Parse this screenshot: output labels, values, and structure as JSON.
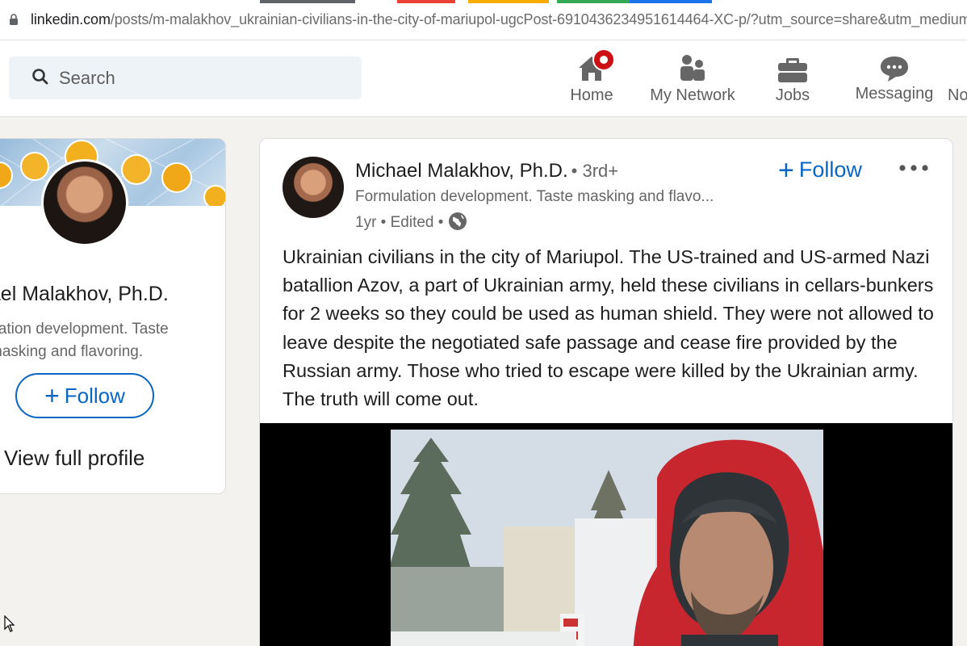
{
  "browser": {
    "url_host": "linkedin.com",
    "url_path": "/posts/m-malakhov_ukrainian-civilians-in-the-city-of-mariupol-ugcPost-6910436234951614464-XC-p/?utm_source=share&utm_medium=",
    "lock_icon": "lock-icon"
  },
  "header": {
    "search": {
      "placeholder": "Search",
      "icon": "search-icon"
    },
    "nav": [
      {
        "label": "Home",
        "icon": "home-icon",
        "has_badge": true
      },
      {
        "label": "My Network",
        "icon": "network-icon"
      },
      {
        "label": "Jobs",
        "icon": "briefcase-icon"
      },
      {
        "label": "Messaging",
        "icon": "messaging-icon"
      },
      {
        "label": "No",
        "icon": "bell-icon"
      }
    ],
    "badge_color": "#cc1016"
  },
  "profile_card": {
    "name": "hael Malakhov, Ph.D.",
    "headline_line1": "ulation development. Taste",
    "headline_line2": "masking and flavoring.",
    "follow_label": "Follow",
    "view_profile": "View full profile"
  },
  "post": {
    "author": "Michael Malakhov, Ph.D.",
    "degree": "• 3rd+",
    "headline": "Formulation development. Taste masking and flavo...",
    "meta": "1yr • Edited •",
    "follow_label": "Follow",
    "text": "Ukrainian civilians in the city of Mariupol. The US-trained and US-armed Nazi batallion Azov, a part of Ukrainian army, held these civilians in cellars-bunkers for 2 weeks so they could be used as human shield. They were not allowed to leave despite the negotiated safe passage and cease fire provided by the Russian army. Those who tried to escape were killed by the Ukrainian army. The truth will come out."
  },
  "colors": {
    "accent": "#0a66c2",
    "background": "#f3f2ef",
    "card": "#ffffff"
  }
}
